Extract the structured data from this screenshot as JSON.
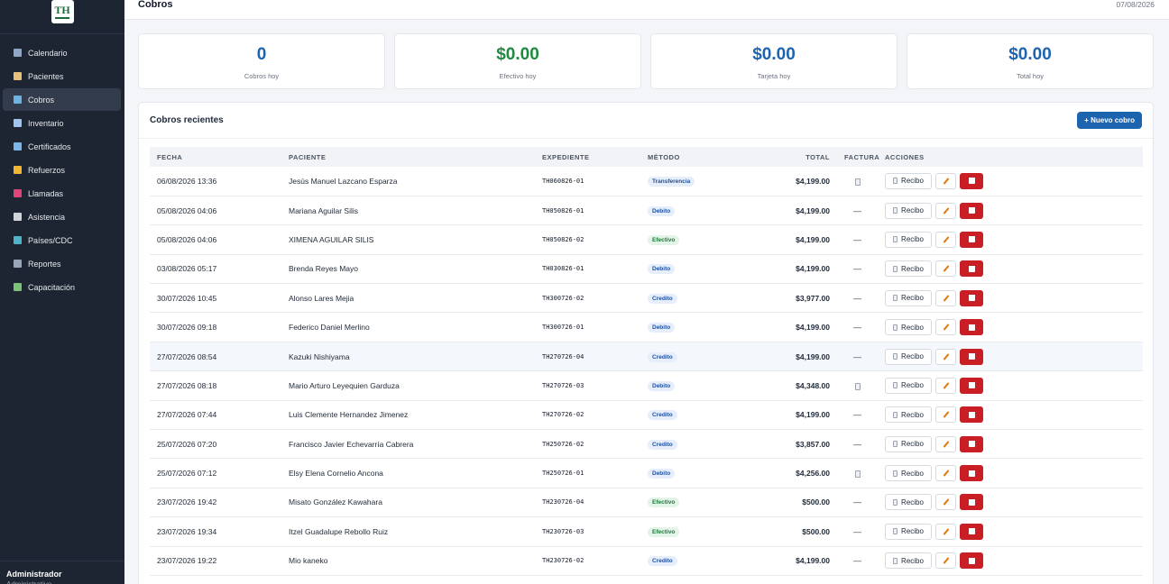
{
  "app": {
    "logo_text": "TH"
  },
  "sidebar": {
    "items": [
      {
        "label": "Calendario",
        "icon": "calendar-icon",
        "color": "#8fa6c7",
        "active": false
      },
      {
        "label": "Pacientes",
        "icon": "clipboard-icon",
        "color": "#e8c07a",
        "active": false
      },
      {
        "label": "Cobros",
        "icon": "card-icon",
        "color": "#6fb3e0",
        "active": true
      },
      {
        "label": "Inventario",
        "icon": "syringe-icon",
        "color": "#9fc5f0",
        "active": false
      },
      {
        "label": "Certificados",
        "icon": "id-card-icon",
        "color": "#7bb6e8",
        "active": false
      },
      {
        "label": "Refuerzos",
        "icon": "bell-icon",
        "color": "#f2b632",
        "active": false
      },
      {
        "label": "Llamadas",
        "icon": "phone-icon",
        "color": "#e0457a",
        "active": false
      },
      {
        "label": "Asistencia",
        "icon": "clock-icon",
        "color": "#d1d5db",
        "active": false
      },
      {
        "label": "Países/CDC",
        "icon": "globe-icon",
        "color": "#4fb3c9",
        "active": false
      },
      {
        "label": "Reportes",
        "icon": "chart-icon",
        "color": "#9aa6b8",
        "active": false
      },
      {
        "label": "Capacitación",
        "icon": "books-icon",
        "color": "#7ec27a",
        "active": false
      }
    ],
    "user": {
      "name": "Administrador",
      "role": "Administrativo"
    }
  },
  "header": {
    "title": "Cobros",
    "date": "07/08/2026"
  },
  "stats": [
    {
      "value": "0",
      "label": "Cobros hoy",
      "color": "#1d64b0"
    },
    {
      "value": "$0.00",
      "label": "Efectivo hoy",
      "color": "#1d8a3f"
    },
    {
      "value": "$0.00",
      "label": "Tarjeta hoy",
      "color": "#1d64b0"
    },
    {
      "value": "$0.00",
      "label": "Total hoy",
      "color": "#1d64b0"
    }
  ],
  "recent": {
    "title": "Cobros recientes",
    "new_button": "+ Nuevo cobro",
    "columns": [
      "FECHA",
      "PACIENTE",
      "EXPEDIENTE",
      "MÉTODO",
      "TOTAL",
      "FACTURA",
      "ACCIONES"
    ],
    "recibo_label": "Recibo",
    "rows": [
      {
        "fecha": "06/08/2026 13:36",
        "paciente": "Jesús Manuel Lazcano Esparza",
        "expediente": "TH060826-01",
        "metodo": "Transferencia",
        "total": "$4,199.00",
        "factura": "doc",
        "highlight": false
      },
      {
        "fecha": "05/08/2026 04:06",
        "paciente": "Mariana Aguilar Silis",
        "expediente": "TH050826-01",
        "metodo": "Debito",
        "total": "$4,199.00",
        "factura": "—",
        "highlight": false
      },
      {
        "fecha": "05/08/2026 04:06",
        "paciente": "XIMENA AGUILAR SILIS",
        "expediente": "TH050826-02",
        "metodo": "Efectivo",
        "total": "$4,199.00",
        "factura": "—",
        "highlight": false
      },
      {
        "fecha": "03/08/2026 05:17",
        "paciente": "Brenda Reyes Mayo",
        "expediente": "TH030826-01",
        "metodo": "Debito",
        "total": "$4,199.00",
        "factura": "—",
        "highlight": false
      },
      {
        "fecha": "30/07/2026 10:45",
        "paciente": "Alonso Lares Mejia",
        "expediente": "TH300726-02",
        "metodo": "Credito",
        "total": "$3,977.00",
        "factura": "—",
        "highlight": false
      },
      {
        "fecha": "30/07/2026 09:18",
        "paciente": "Federico Daniel Merlino",
        "expediente": "TH300726-01",
        "metodo": "Debito",
        "total": "$4,199.00",
        "factura": "—",
        "highlight": false
      },
      {
        "fecha": "27/07/2026 08:54",
        "paciente": "Kazuki Nishiyama",
        "expediente": "TH270726-04",
        "metodo": "Credito",
        "total": "$4,199.00",
        "factura": "—",
        "highlight": true
      },
      {
        "fecha": "27/07/2026 08:18",
        "paciente": "Mario Arturo Leyequien Garduza",
        "expediente": "TH270726-03",
        "metodo": "Debito",
        "total": "$4,348.00",
        "factura": "doc",
        "highlight": false
      },
      {
        "fecha": "27/07/2026 07:44",
        "paciente": "Luis Clemente Hernandez Jimenez",
        "expediente": "TH270726-02",
        "metodo": "Credito",
        "total": "$4,199.00",
        "factura": "—",
        "highlight": false
      },
      {
        "fecha": "25/07/2026 07:20",
        "paciente": "Francisco Javier Echevarría Cabrera",
        "expediente": "TH250726-02",
        "metodo": "Credito",
        "total": "$3,857.00",
        "factura": "—",
        "highlight": false
      },
      {
        "fecha": "25/07/2026 07:12",
        "paciente": "Elsy Elena Cornelio Ancona",
        "expediente": "TH250726-01",
        "metodo": "Debito",
        "total": "$4,256.00",
        "factura": "doc",
        "highlight": false
      },
      {
        "fecha": "23/07/2026 19:42",
        "paciente": "Misato González Kawahara",
        "expediente": "TH230726-04",
        "metodo": "Efectivo",
        "total": "$500.00",
        "factura": "—",
        "highlight": false
      },
      {
        "fecha": "23/07/2026 19:34",
        "paciente": "Itzel Guadalupe Rebollo Ruiz",
        "expediente": "TH230726-03",
        "metodo": "Efectivo",
        "total": "$500.00",
        "factura": "—",
        "highlight": false
      },
      {
        "fecha": "23/07/2026 19:22",
        "paciente": "Mio kaneko",
        "expediente": "TH230726-02",
        "metodo": "Credito",
        "total": "$4,199.00",
        "factura": "—",
        "highlight": false
      }
    ]
  }
}
